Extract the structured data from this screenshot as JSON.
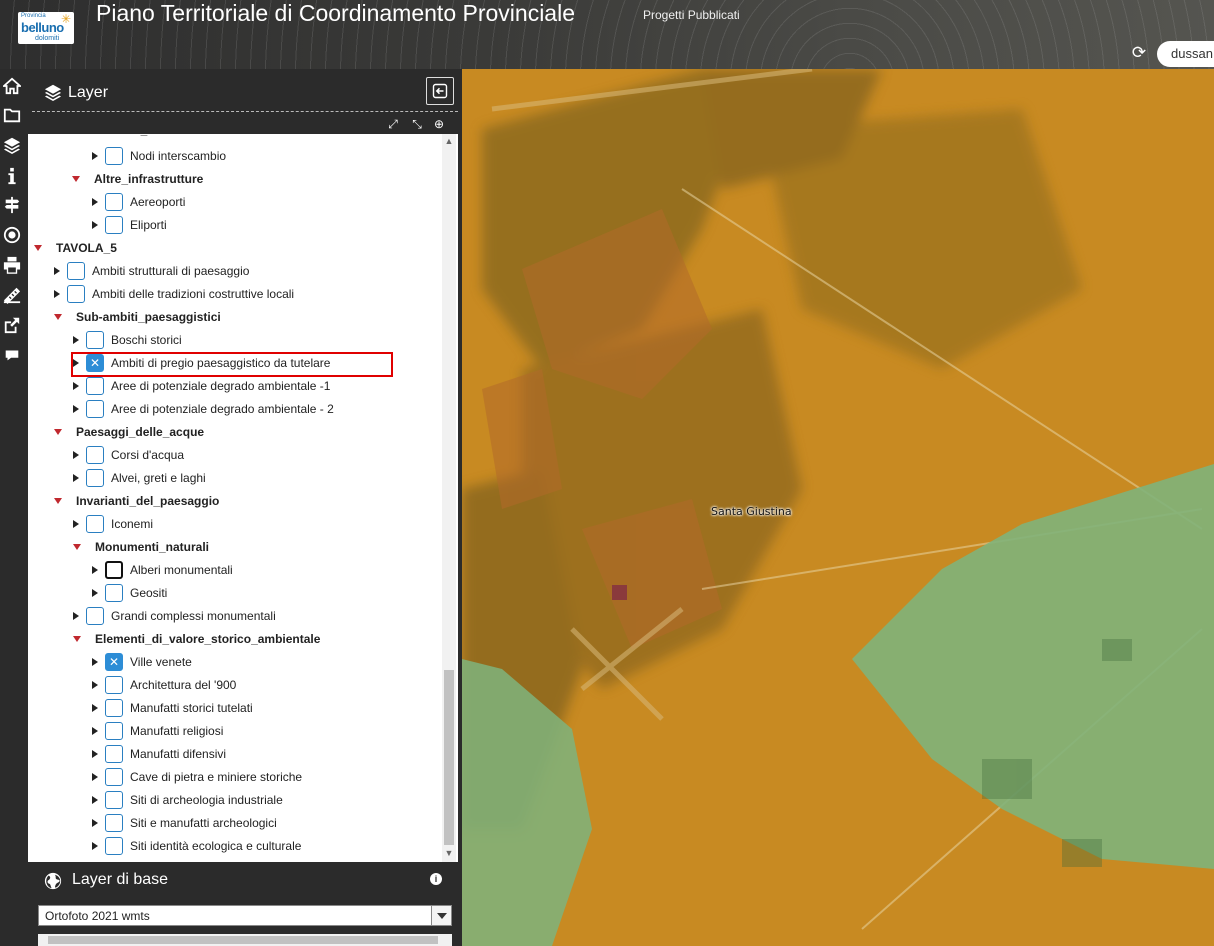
{
  "header": {
    "logo": {
      "line1": "Provincia",
      "line2": "belluno",
      "line3": "dolomiti"
    },
    "title": "Piano Territoriale di Coordinamento Provinciale",
    "subtitle": "Progetti Pubblicati",
    "user": "dussan"
  },
  "toolbar": {
    "icons": [
      "home-icon",
      "folder-icon",
      "layers-icon",
      "info-icon",
      "signpost-icon",
      "target-icon",
      "print-icon",
      "ruler-icon",
      "share-icon",
      "comment-icon"
    ]
  },
  "layer_panel": {
    "title": "Layer",
    "tree": [
      {
        "label": "Nodi_intermodali",
        "kind": "group"
      },
      {
        "label": "Nodi interscambio",
        "kind": "layer",
        "checked": false
      },
      {
        "label": "Altre_infrastrutture",
        "kind": "group"
      },
      {
        "label": "Aereoporti",
        "kind": "layer",
        "checked": false
      },
      {
        "label": "Eliporti",
        "kind": "layer",
        "checked": false
      },
      {
        "label": "TAVOLA_5",
        "kind": "group"
      },
      {
        "label": "Ambiti strutturali di paesaggio",
        "kind": "layer",
        "checked": false
      },
      {
        "label": "Ambiti delle tradizioni costruttive locali",
        "kind": "layer",
        "checked": false
      },
      {
        "label": "Sub-ambiti_paesaggistici",
        "kind": "group"
      },
      {
        "label": "Boschi storici",
        "kind": "layer",
        "checked": false
      },
      {
        "label": "Ambiti di pregio paesaggistico da tutelare",
        "kind": "layer",
        "checked": true
      },
      {
        "label": "Aree di potenziale degrado ambientale -1",
        "kind": "layer",
        "checked": false
      },
      {
        "label": "Aree di potenziale degrado ambientale - 2",
        "kind": "layer",
        "checked": false
      },
      {
        "label": "Paesaggi_delle_acque",
        "kind": "group"
      },
      {
        "label": "Corsi d'acqua",
        "kind": "layer",
        "checked": false
      },
      {
        "label": "Alvei, greti e laghi",
        "kind": "layer",
        "checked": false
      },
      {
        "label": "Invarianti_del_paesaggio",
        "kind": "group"
      },
      {
        "label": "Iconemi",
        "kind": "layer",
        "checked": false
      },
      {
        "label": "Monumenti_naturali",
        "kind": "group"
      },
      {
        "label": "Alberi monumentali",
        "kind": "layer",
        "checked": false
      },
      {
        "label": "Geositi",
        "kind": "layer",
        "checked": false
      },
      {
        "label": "Grandi complessi monumentali",
        "kind": "layer",
        "checked": false
      },
      {
        "label": "Elementi_di_valore_storico_ambientale",
        "kind": "group"
      },
      {
        "label": "Ville venete",
        "kind": "layer",
        "checked": true
      },
      {
        "label": "Architettura del '900",
        "kind": "layer",
        "checked": false
      },
      {
        "label": "Manufatti storici tutelati",
        "kind": "layer",
        "checked": false
      },
      {
        "label": "Manufatti religiosi",
        "kind": "layer",
        "checked": false
      },
      {
        "label": "Manufatti difensivi",
        "kind": "layer",
        "checked": false
      },
      {
        "label": "Cave di pietra e miniere storiche",
        "kind": "layer",
        "checked": false
      },
      {
        "label": "Siti di archeologia industriale",
        "kind": "layer",
        "checked": false
      },
      {
        "label": "Siti e manufatti archeologici",
        "kind": "layer",
        "checked": false
      },
      {
        "label": "Siti identità ecologica e culturale",
        "kind": "layer",
        "checked": false
      }
    ]
  },
  "base_panel": {
    "title": "Layer di base",
    "selected": "Ortofoto 2021 wmts"
  },
  "map": {
    "place_label": "Santa Giustina"
  },
  "colors": {
    "overlay_orange": "#c98a21",
    "overlay_green": "#7fb27a",
    "checkbox_blue": "#2d8dd6",
    "highlight_red": "#e00000",
    "toggle_red": "#c0282e"
  }
}
